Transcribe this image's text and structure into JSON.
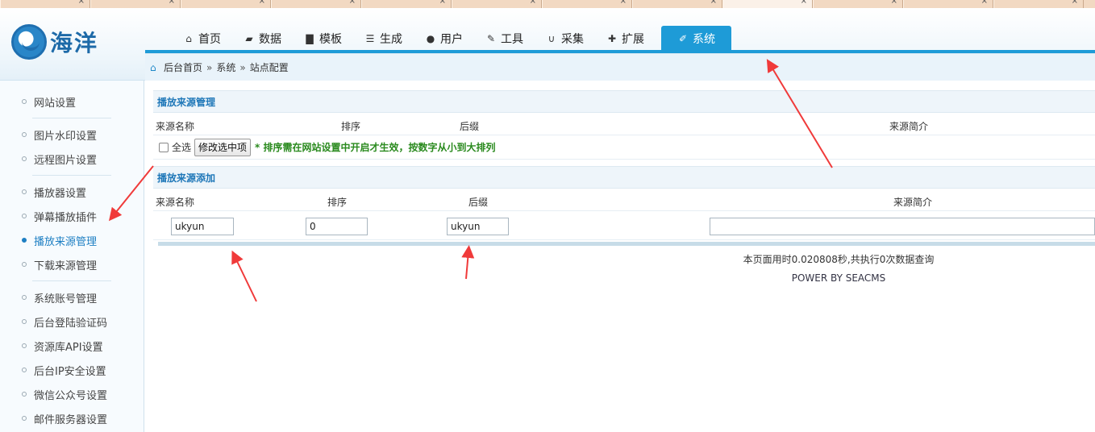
{
  "header": {
    "logo_text": "海洋",
    "nav": [
      {
        "label": "首页",
        "icon": "home-icon"
      },
      {
        "label": "数据",
        "icon": "book-icon"
      },
      {
        "label": "模板",
        "icon": "file-icon"
      },
      {
        "label": "生成",
        "icon": "server-icon"
      },
      {
        "label": "用户",
        "icon": "user-icon"
      },
      {
        "label": "工具",
        "icon": "wrench-icon"
      },
      {
        "label": "采集",
        "icon": "magnet-icon"
      },
      {
        "label": "扩展",
        "icon": "puzzle-icon"
      },
      {
        "label": "系统",
        "icon": "edit-icon",
        "active": true
      }
    ]
  },
  "breadcrumb": {
    "home": "后台首页",
    "sep": "»",
    "level1": "系统",
    "level2": "站点配置"
  },
  "sidebar": {
    "groups": [
      [
        "网站设置"
      ],
      [
        "图片水印设置",
        "远程图片设置"
      ],
      [
        "播放器设置",
        "弹幕播放插件",
        "播放来源管理",
        "下载来源管理"
      ],
      [
        "系统账号管理",
        "后台登陆验证码",
        "资源库API设置",
        "后台IP安全设置",
        "微信公众号设置",
        "邮件服务器设置"
      ]
    ],
    "active": "播放来源管理"
  },
  "manage_section": {
    "title": "播放来源管理",
    "columns": [
      "来源名称",
      "排序",
      "后缀",
      "来源简介"
    ],
    "select_all_label": "全选",
    "modify_button": "修改选中项",
    "note": "* 排序需在网站设置中开启才生效，按数字从小到大排列"
  },
  "add_section": {
    "title": "播放来源添加",
    "columns": [
      "来源名称",
      "排序",
      "后缀",
      "来源简介"
    ],
    "values": {
      "name": "ukyun",
      "order": "0",
      "suffix": "ukyun",
      "intro": ""
    }
  },
  "footer": {
    "timing": "本页面用时0.020808秒,共执行0次数据查询",
    "power": "POWER BY SEACMS"
  },
  "colors": {
    "accent": "#1e9bd7",
    "note_green": "#2a8a1e",
    "arrow_red": "#f03a3a"
  }
}
